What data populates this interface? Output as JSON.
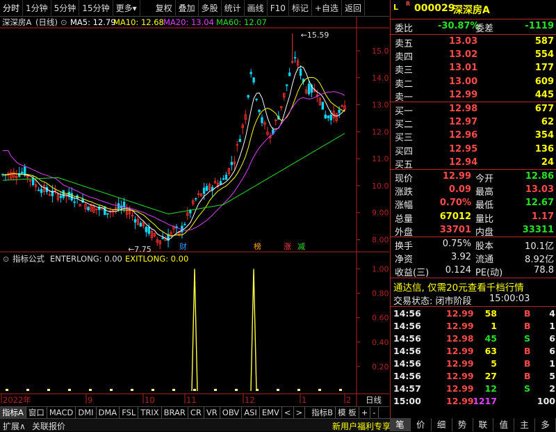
{
  "toolbar": {
    "items": [
      "分时",
      "1分钟",
      "5分钟",
      "15分钟",
      "更多▾",
      "复权",
      "叠加",
      "多股",
      "统计",
      "画线",
      "F10",
      "标记",
      "+自选",
      "返回"
    ]
  },
  "chart_header": {
    "name": "深深房A",
    "period": "(日线)",
    "ma5": "MA5: 12.79",
    "ma10": "MA10: 12.68",
    "ma20": "MA20: 13.04",
    "ma60": "MA60: 12.07"
  },
  "colors": {
    "up": "#ff3030",
    "down": "#00d8ff",
    "ma5": "#ffffff",
    "ma10": "#ffff00",
    "ma20": "#e040ff",
    "ma60": "#26e026",
    "axis": "#b22222"
  },
  "chart_data": [
    {
      "type": "candlestick",
      "y_ticks": [
        "15.00",
        "14.00",
        "13.00",
        "12.00",
        "11.00",
        "10.00",
        "9.00",
        "8.00"
      ],
      "ylim": [
        7.6,
        15.8
      ],
      "annotations": {
        "high": "15.59",
        "low": "7.75"
      },
      "events": [
        "财",
        "榜",
        "涨",
        "减"
      ]
    },
    {
      "type": "line",
      "title": "指标公式 ENTERLONG: 0.00 EXITLONG: 0.00",
      "y_ticks": [
        "1.00",
        "0.80",
        "0.60",
        "0.40",
        "0.20"
      ],
      "ylim": [
        0,
        1.1
      ],
      "spike_positions": [
        11,
        12
      ],
      "series": [
        {
          "name": "ENTERLONG",
          "values": [
            0,
            0,
            0,
            0,
            0,
            0,
            0,
            0,
            0,
            0,
            1,
            1,
            0,
            0,
            0,
            0,
            0
          ]
        }
      ]
    }
  ],
  "indicator_header": {
    "title": "指标公式",
    "enterlong": "ENTERLONG: 0.00",
    "exitlong": "EXITLONG: 0.00"
  },
  "x_axis": {
    "labels": [
      "2022年",
      "9",
      "10",
      "11",
      "12",
      "1",
      "2"
    ],
    "corner": "日线"
  },
  "tabs": [
    "指标A",
    "窗口",
    "MACD",
    "DMI",
    "DMA",
    "FSL",
    "TRIX",
    "BRAR",
    "CR",
    "VR",
    "OBV",
    "ASI",
    "EMV",
    "<",
    ">",
    "指标B",
    "模 板",
    "+",
    "-"
  ],
  "status_bar": {
    "expand": "扩展∧",
    "related": "关联报价",
    "promo": "新用户福利专享"
  },
  "quote": {
    "header": {
      "l": "L",
      "r": "R",
      "code": "000029",
      "name": "深深房A"
    },
    "webi": {
      "label": "委比",
      "value": "-30.87%",
      "label2": "委差",
      "value2": "-1119"
    },
    "sells": [
      {
        "label": "卖五",
        "price": "13.03",
        "vol": "587"
      },
      {
        "label": "卖四",
        "price": "13.02",
        "vol": "554"
      },
      {
        "label": "卖三",
        "price": "13.01",
        "vol": "177"
      },
      {
        "label": "卖二",
        "price": "13.00",
        "vol": "609"
      },
      {
        "label": "卖一",
        "price": "12.99",
        "vol": "445"
      }
    ],
    "buys": [
      {
        "label": "买一",
        "price": "12.98",
        "vol": "677"
      },
      {
        "label": "买二",
        "price": "12.97",
        "vol": "62"
      },
      {
        "label": "买三",
        "price": "12.96",
        "vol": "354"
      },
      {
        "label": "买四",
        "price": "12.95",
        "vol": "136"
      },
      {
        "label": "买五",
        "price": "12.94",
        "vol": "24"
      }
    ],
    "stats": [
      {
        "l1": "现价",
        "v1": "12.99",
        "l2": "今开",
        "v2": "12.86"
      },
      {
        "l1": "涨跌",
        "v1": "0.09",
        "l2": "最高",
        "v2": "13.03"
      },
      {
        "l1": "涨幅",
        "v1": "0.70%",
        "l2": "最低",
        "v2": "12.67"
      },
      {
        "l1": "总量",
        "v1": "67012",
        "l2": "量比",
        "v2": "1.17"
      },
      {
        "l1": "外盘",
        "v1": "33701",
        "l2": "内盘",
        "v2": "33311"
      }
    ],
    "stats2": [
      {
        "l1": "换手",
        "v1": "0.75%",
        "l2": "股本",
        "v2": "10.1亿"
      },
      {
        "l1": "净资",
        "v1": "3.92",
        "l2": "流通",
        "v2": "8.92亿"
      },
      {
        "l1": "收益(三)",
        "v1": "0.124",
        "l2": "PE(动)",
        "v2": "78.8"
      }
    ],
    "ad": "通达信, 仅需20元查看千档行情",
    "trade_state": {
      "label": "交易状态: 闭市阶段",
      "time": "15:00:03"
    },
    "ticks": [
      {
        "time": "14:56",
        "price": "12.99",
        "vol": "58",
        "bs": "B",
        "n": "4"
      },
      {
        "time": "14:56",
        "price": "12.99",
        "vol": "1",
        "bs": "B",
        "n": "1"
      },
      {
        "time": "14:56",
        "price": "12.98",
        "vol": "45",
        "bs": "S",
        "n": "6"
      },
      {
        "time": "14:56",
        "price": "12.99",
        "vol": "63",
        "bs": "B",
        "n": "6"
      },
      {
        "time": "14:56",
        "price": "12.99",
        "vol": "5",
        "bs": "B",
        "n": "1"
      },
      {
        "time": "14:56",
        "price": "12.99",
        "vol": "27",
        "bs": "B",
        "n": "5"
      },
      {
        "time": "14:57",
        "price": "12.99",
        "vol": "12",
        "bs": "S",
        "n": "2"
      },
      {
        "time": "15:00",
        "price": "12.99",
        "vol": "1217",
        "bs": "",
        "n": "100"
      }
    ],
    "bottom_tabs": [
      "笔",
      "价",
      "细",
      "势",
      "联",
      "值",
      "主",
      "多"
    ]
  }
}
